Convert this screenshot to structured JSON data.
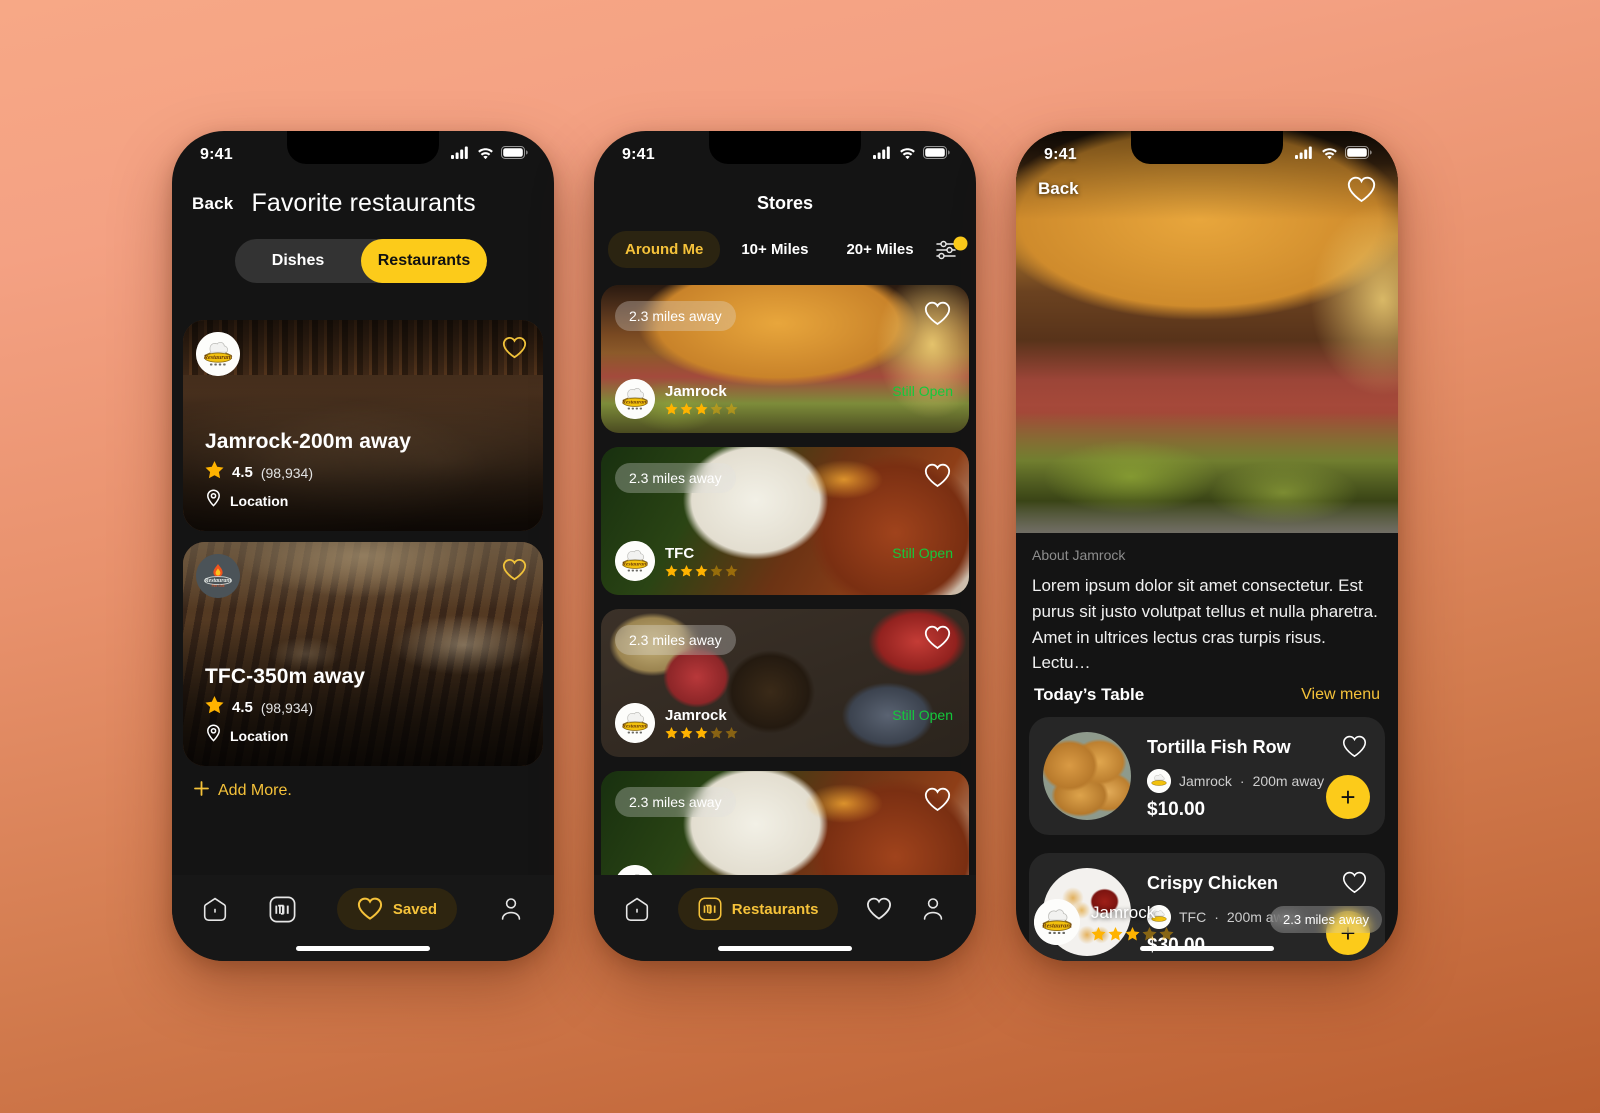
{
  "background": {
    "top_color": "#f7a886",
    "bottom_color": "#bb5f31"
  },
  "theme": {
    "accent": "#fccb1a",
    "accent_text": "#f5c23a",
    "open_green": "#14c93c",
    "surface": "#141414",
    "card": "#262626"
  },
  "status_bar": {
    "time": "9:41",
    "signal_icon": "cellular-bars-icon",
    "wifi_icon": "wifi-icon",
    "battery_icon": "battery-icon"
  },
  "phone1": {
    "back_label": "Back",
    "title": "Favorite restaurants",
    "segment": {
      "options": [
        "Dishes",
        "Restaurants"
      ],
      "selected": "Restaurants"
    },
    "cards": [
      {
        "name": "Jamrock-200m away",
        "rating": "4.5",
        "reviews": "(98,934)",
        "location_label": "Location",
        "logo": "restaurant-chef-logo",
        "favorited": true
      },
      {
        "name": "TFC-350m away",
        "rating": "4.5",
        "reviews": "(98,934)",
        "location_label": "Location",
        "logo": "restaurant-flame-logo",
        "favorited": true
      }
    ],
    "add_more_label": "Add More.",
    "tabbar": [
      {
        "label": "",
        "icon": "home-icon",
        "active": false
      },
      {
        "label": "",
        "icon": "mi-restaurants-icon",
        "active": false
      },
      {
        "label": "Saved",
        "icon": "heart-icon",
        "active": true
      },
      {
        "label": "",
        "icon": "person-icon",
        "active": false
      }
    ]
  },
  "phone2": {
    "title": "Stores",
    "filters": [
      {
        "label": "Around Me",
        "active": true
      },
      {
        "label": "10+ Miles",
        "active": false
      },
      {
        "label": "20+ Miles",
        "active": false
      }
    ],
    "filter_icon": "sliders-icon",
    "filter_badge": true,
    "cards": [
      {
        "distance": "2.3 miles away",
        "brand": "Jamrock",
        "stars": 3,
        "max_stars": 5,
        "status": "Still Open",
        "photo": "burger-and-fries"
      },
      {
        "distance": "2.3 miles away",
        "brand": "TFC",
        "stars": 3,
        "max_stars": 5,
        "status": "Still Open",
        "photo": "fish-and-greens"
      },
      {
        "distance": "2.3 miles away",
        "brand": "Jamrock",
        "stars": 3,
        "max_stars": 5,
        "status": "Still Open",
        "photo": "noodles-platter"
      },
      {
        "distance": "2.3 miles away",
        "brand": "",
        "stars": 0,
        "max_stars": 5,
        "status": "",
        "photo": "fish-and-greens"
      }
    ],
    "tabbar": [
      {
        "label": "",
        "icon": "home-icon",
        "active": false
      },
      {
        "label": "Restaurants",
        "icon": "mi-restaurants-icon",
        "active": true
      },
      {
        "label": "",
        "icon": "heart-icon",
        "active": false
      },
      {
        "label": "",
        "icon": "person-icon",
        "active": false
      }
    ]
  },
  "phone3": {
    "back_label": "Back",
    "hero": {
      "brand": "Jamrock",
      "stars": 3,
      "max_stars": 5,
      "distance": "2.3 miles away",
      "favorited": false,
      "photo": "cheeseburger-closeup"
    },
    "about_label": "About Jamrock",
    "about_text": "Lorem ipsum dolor sit amet consectetur. Est purus sit justo volutpat tellus et nulla pharetra. Amet in ultrices lectus cras turpis risus. Lectu…",
    "today_title": "Today’s Table",
    "view_menu_label": "View menu",
    "menu_items": [
      {
        "name": "Tortilla Fish Row",
        "restaurant": "Jamrock",
        "distance": "200m away",
        "price": "$10.00",
        "thumb": "tortilla-rolls",
        "add_label": "+"
      },
      {
        "name": "Crispy Chicken",
        "restaurant": "TFC",
        "distance": "200m away",
        "price": "$30.00",
        "thumb": "crispy-chicken",
        "add_label": "+"
      }
    ]
  }
}
